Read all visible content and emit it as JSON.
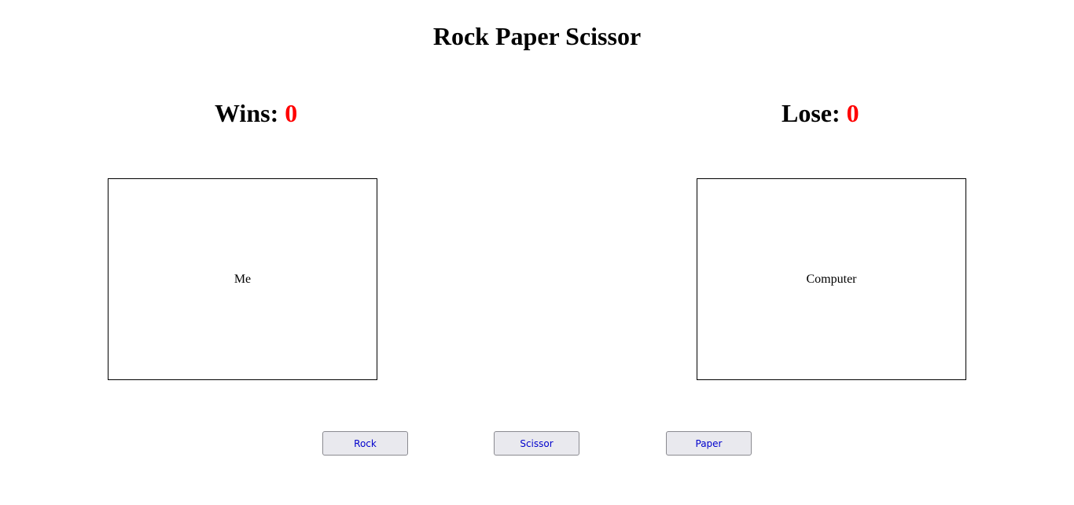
{
  "title": "Rock Paper Scissor",
  "score": {
    "wins_label": "Wins: ",
    "wins_value": "0",
    "lose_label": "Lose: ",
    "lose_value": "0",
    "value_color": "#ff0000"
  },
  "boxes": {
    "me": "Me",
    "computer": "Computer"
  },
  "buttons": {
    "rock": "Rock",
    "scissor": "Scissor",
    "paper": "Paper"
  }
}
